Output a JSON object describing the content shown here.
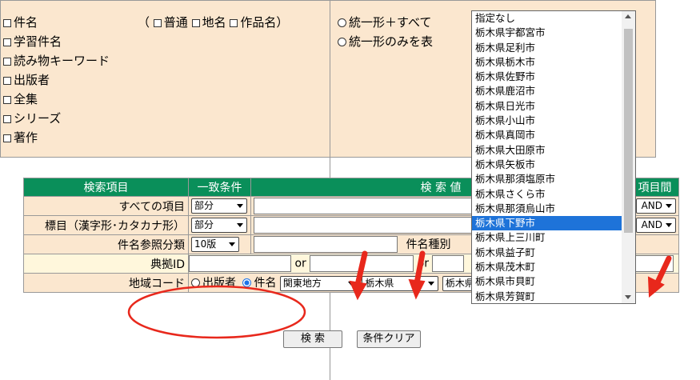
{
  "options": {
    "left_items": [
      "件名",
      "学習件名",
      "読み物キーワード",
      "出版者",
      "全集",
      "シリーズ",
      "著作"
    ],
    "kenmei_sub": [
      "普通",
      "地名",
      "作品名"
    ],
    "right_items": [
      "統一形＋すべて",
      "統一形のみを表"
    ]
  },
  "table": {
    "headers": [
      "検索項目",
      "一致条件",
      "検 索 値",
      "項目間"
    ],
    "rows": [
      {
        "label": "すべての項目",
        "cond": "部分",
        "op": "AND"
      },
      {
        "label": "標目（漢字形･カタカナ形）",
        "cond": "部分",
        "op": "AND"
      },
      {
        "label": "件名参照分類",
        "cond": "10版",
        "extra": "件名種別"
      },
      {
        "label": "典拠ID",
        "or1": "or",
        "or2": "or"
      },
      {
        "label": "地域コード",
        "radio1": "出版者",
        "radio2": "件名",
        "region": "関東地方",
        "pref": "栃木県",
        "city": "栃木県下野市"
      }
    ]
  },
  "dropdown_items": [
    "指定なし",
    "栃木県宇都宮市",
    "栃木県足利市",
    "栃木県栃木市",
    "栃木県佐野市",
    "栃木県鹿沼市",
    "栃木県日光市",
    "栃木県小山市",
    "栃木県真岡市",
    "栃木県大田原市",
    "栃木県矢板市",
    "栃木県那須塩原市",
    "栃木県さくら市",
    "栃木県那須烏山市",
    "栃木県下野市",
    "栃木県上三川町",
    "栃木県益子町",
    "栃木県茂木町",
    "栃木県市貝町",
    "栃木県芳賀町"
  ],
  "dropdown_selected": "栃木県下野市",
  "buttons": {
    "search": "検 索",
    "clear": "条件クリア"
  },
  "colors": {
    "header": "#0a8f5a",
    "highlight": "#1e73d9",
    "annotation": "#e8281c"
  }
}
